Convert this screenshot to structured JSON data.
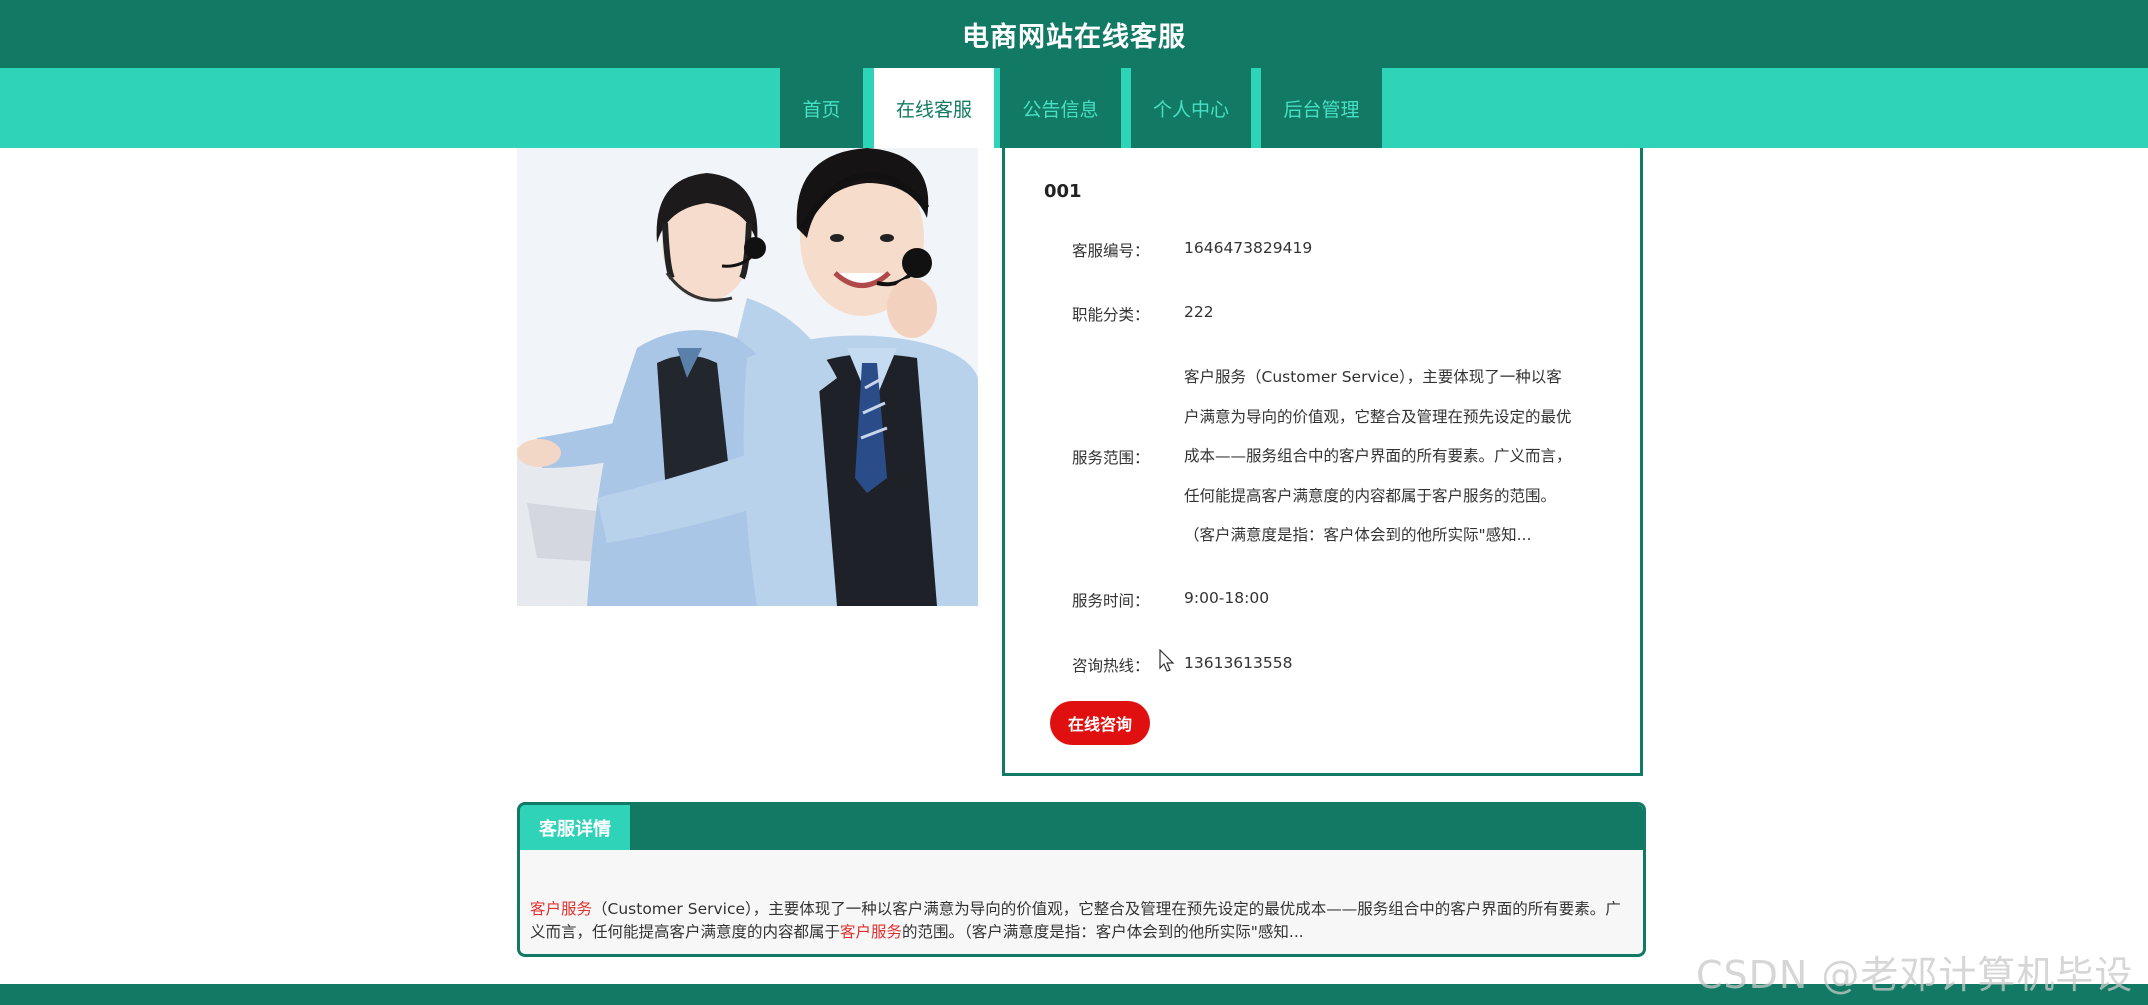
{
  "header": {
    "title": "电商网站在线客服"
  },
  "nav": {
    "items": [
      {
        "label": "首页"
      },
      {
        "label": "在线客服"
      },
      {
        "label": "公告信息"
      },
      {
        "label": "个人中心"
      },
      {
        "label": "后台管理"
      }
    ],
    "active": "在线客服"
  },
  "service": {
    "name": "001",
    "id_label": "客服编号：",
    "id_value": "1646473829419",
    "category_label": "职能分类：",
    "category_value": "222",
    "scope_label": "服务范围：",
    "scope_value": "客户服务（Customer Service），主要体现了一种以客户满意为导向的价值观，它整合及管理在预先设定的最优成本——服务组合中的客户界面的所有要素。广义而言，任何能提高客户满意度的内容都属于客户服务的范围。（客户满意度是指：客户体会到的他所实际\"感知...",
    "time_label": "服务时间：",
    "time_value": "9:00-18:00",
    "hotline_label": "咨询热线：",
    "hotline_value": "13613613558",
    "consult_button": "在线咨询"
  },
  "detail": {
    "tab_label": "客服详情",
    "text_hl1": "客户服务",
    "text_part1": "（Customer Service），主要体现了一种以客户满意为导向的价值观，它整合及管理在预先设定的最优成本——服务组合中的客户界面的所有要素。广义而言，任何能提高客户满意度的内容都属于",
    "text_hl2": "客户服务",
    "text_part2": "的范围。（客户满意度是指：客户体会到的他所实际\"感知..."
  },
  "watermark": "CSDN @老邓计算机毕设",
  "colors": {
    "primary": "#127a64",
    "accent": "#2fd3b8",
    "button": "#e01010",
    "highlight": "#e03030"
  }
}
